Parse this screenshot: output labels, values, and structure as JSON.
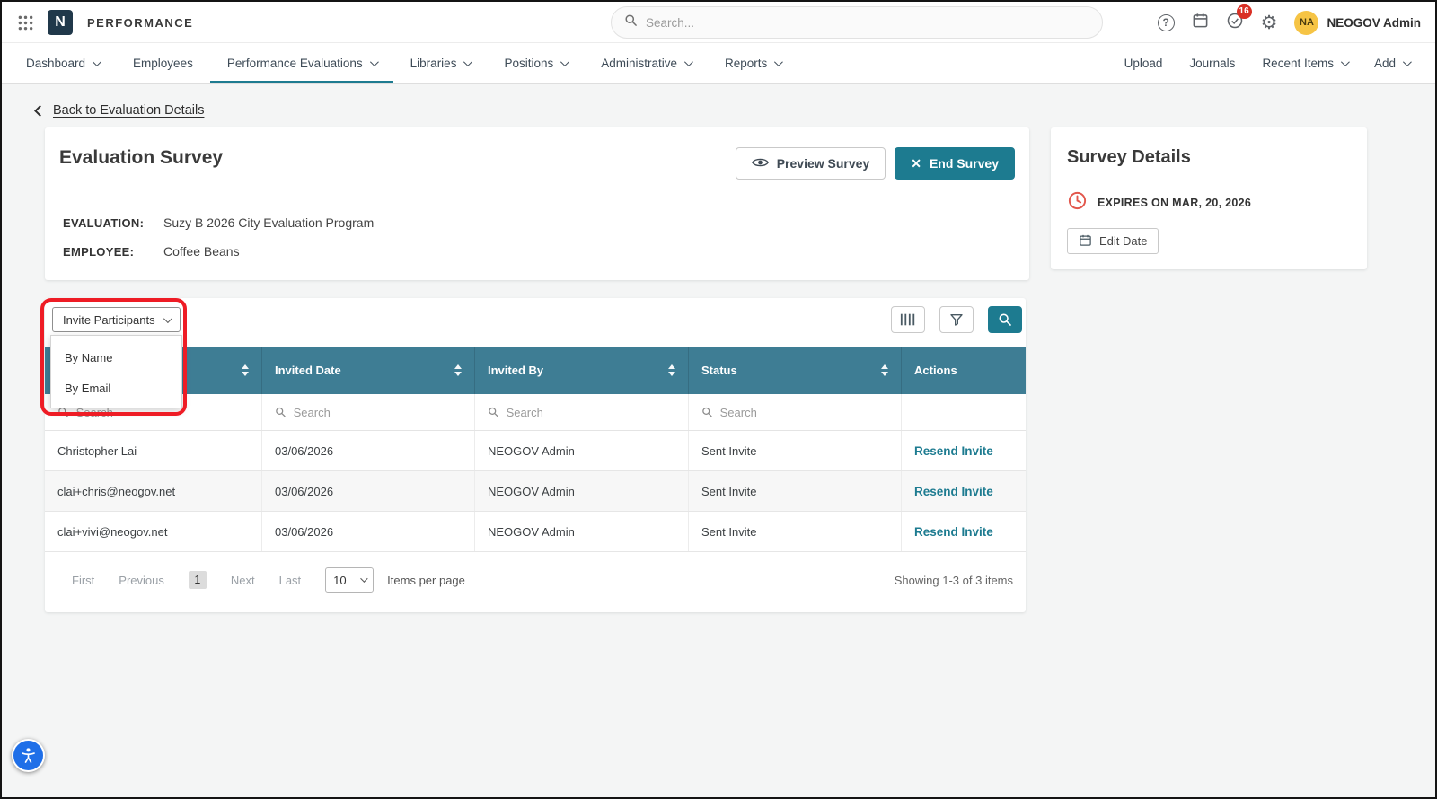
{
  "colors": {
    "accent": "#1d7b90",
    "table-header": "#3e7d94",
    "annotation": "#ee1c25",
    "badge": "#d93025",
    "avatar": "#f6c445",
    "logo-bg": "#20384a"
  },
  "topbar": {
    "logo_letter": "N",
    "brand": "PERFORMANCE",
    "search_placeholder": "Search...",
    "badge_count": "16",
    "user_initials": "NA",
    "user_name": "NEOGOV Admin"
  },
  "nav": {
    "items": [
      {
        "label": "Dashboard"
      },
      {
        "label": "Employees"
      },
      {
        "label": "Performance Evaluations"
      },
      {
        "label": "Libraries"
      },
      {
        "label": "Positions"
      },
      {
        "label": "Administrative"
      },
      {
        "label": "Reports"
      }
    ],
    "right": [
      {
        "label": "Upload"
      },
      {
        "label": "Journals"
      },
      {
        "label": "Recent Items"
      },
      {
        "label": "Add"
      }
    ]
  },
  "back_link": "Back to Evaluation Details",
  "survey": {
    "title": "Evaluation Survey",
    "preview_button": "Preview Survey",
    "end_button": "End Survey",
    "evaluation_label": "EVALUATION:",
    "evaluation_value": "Suzy B 2026 City Evaluation Program",
    "employee_label": "EMPLOYEE:",
    "employee_value": "Coffee Beans"
  },
  "details": {
    "title": "Survey Details",
    "expires": "EXPIRES ON MAR, 20, 2026",
    "edit_date": "Edit Date"
  },
  "table": {
    "invite_button": "Invite Participants",
    "menu": [
      "By Name",
      "By Email"
    ],
    "columns": {
      "participant": "",
      "invited_date": "Invited Date",
      "invited_by": "Invited By",
      "status": "Status",
      "actions": "Actions"
    },
    "search_placeholder": "Search",
    "rows": [
      {
        "participant": "Christopher Lai",
        "invited_date": "03/06/2026",
        "invited_by": "NEOGOV Admin",
        "status": "Sent Invite",
        "action": "Resend Invite"
      },
      {
        "participant": "clai+chris@neogov.net",
        "invited_date": "03/06/2026",
        "invited_by": "NEOGOV Admin",
        "status": "Sent Invite",
        "action": "Resend Invite"
      },
      {
        "participant": "clai+vivi@neogov.net",
        "invited_date": "03/06/2026",
        "invited_by": "NEOGOV Admin",
        "status": "Sent Invite",
        "action": "Resend Invite"
      }
    ],
    "pagination": {
      "first": "First",
      "previous": "Previous",
      "page": "1",
      "next": "Next",
      "last": "Last",
      "per_page": "10",
      "per_page_label": "Items per page",
      "showing": "Showing 1-3 of 3 items"
    }
  }
}
